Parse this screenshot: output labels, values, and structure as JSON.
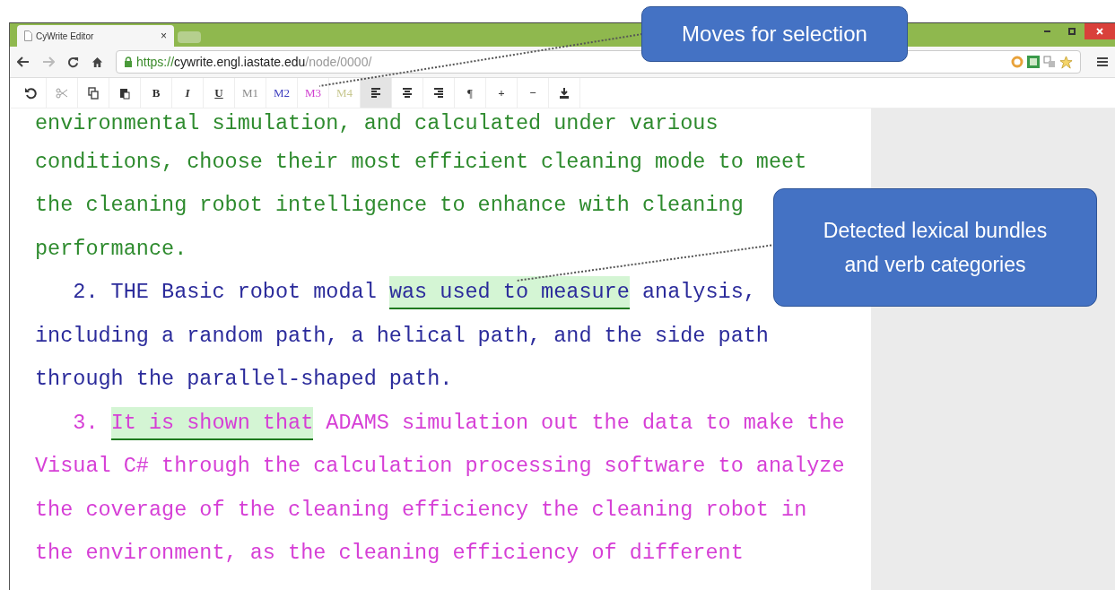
{
  "browser": {
    "tab_title": "CyWrite Editor",
    "tab_close": "×",
    "url_secure": "https://",
    "url_host": "cywrite.engl.iastate.edu",
    "url_path": "/node/0000/"
  },
  "toolbar": [
    {
      "kind": "undo",
      "selected": false
    },
    {
      "kind": "cut",
      "selected": false
    },
    {
      "kind": "copy",
      "selected": false
    },
    {
      "kind": "paste",
      "selected": false
    },
    {
      "kind": "bold",
      "label": "B",
      "selected": false
    },
    {
      "kind": "italic",
      "label": "I",
      "selected": false
    },
    {
      "kind": "underline",
      "label": "U",
      "selected": false
    },
    {
      "kind": "marker",
      "label": "M1",
      "color": "#8a8a8a",
      "selected": false
    },
    {
      "kind": "marker",
      "label": "M2",
      "color": "#4040c0",
      "selected": false
    },
    {
      "kind": "marker",
      "label": "M3",
      "color": "#d040d0",
      "selected": false
    },
    {
      "kind": "marker",
      "label": "M4",
      "color": "#c8c890",
      "selected": false
    },
    {
      "kind": "align-left",
      "selected": true
    },
    {
      "kind": "align-center",
      "selected": false
    },
    {
      "kind": "align-right",
      "selected": false
    },
    {
      "kind": "plain",
      "label": "¶",
      "selected": false
    },
    {
      "kind": "bold",
      "label": "+",
      "selected": false
    },
    {
      "kind": "bold",
      "label": "−",
      "selected": false
    },
    {
      "kind": "download",
      "selected": false
    }
  ],
  "paragraphs": [
    {
      "color": "#2e8b2e",
      "lines": [
        [
          {
            "text": "environmental simulation, and calculated under various",
            "highlighted": false
          }
        ],
        [
          {
            "text": "conditions, choose their most efficient cleaning mode to meet",
            "highlighted": false
          }
        ],
        [
          {
            "text": "the cleaning robot intelligence to enhance with cleaning",
            "highlighted": false
          }
        ],
        [
          {
            "text": "performance.",
            "highlighted": false
          }
        ]
      ]
    },
    {
      "color": "#2b2b9b",
      "lines": [
        [
          {
            "text": "   2. THE Basic robot modal ",
            "highlighted": false
          },
          {
            "text": "was used to measure",
            "highlighted": true
          },
          {
            "text": " analysis,",
            "highlighted": false
          }
        ],
        [
          {
            "text": "including a random path, a helical path, and the side path",
            "highlighted": false
          }
        ],
        [
          {
            "text": "through the parallel-shaped path.",
            "highlighted": false
          }
        ]
      ]
    },
    {
      "color": "#d63fd6",
      "lines": [
        [
          {
            "text": "   3. ",
            "highlighted": false
          },
          {
            "text": "It is shown that",
            "highlighted": true
          },
          {
            "text": " ADAMS simulation out the data to make the",
            "highlighted": false
          }
        ],
        [
          {
            "text": "Visual C# through the calculation processing software to analyze",
            "highlighted": false
          }
        ],
        [
          {
            "text": "the coverage of the cleaning efficiency the cleaning robot in",
            "highlighted": false
          }
        ],
        [
          {
            "text": "the environment, as the cleaning efficiency of different",
            "highlighted": false
          }
        ]
      ]
    }
  ],
  "callouts": [
    {
      "text": "Moves for selection"
    },
    {
      "text": "Detected lexical bundles and verb categories"
    }
  ]
}
